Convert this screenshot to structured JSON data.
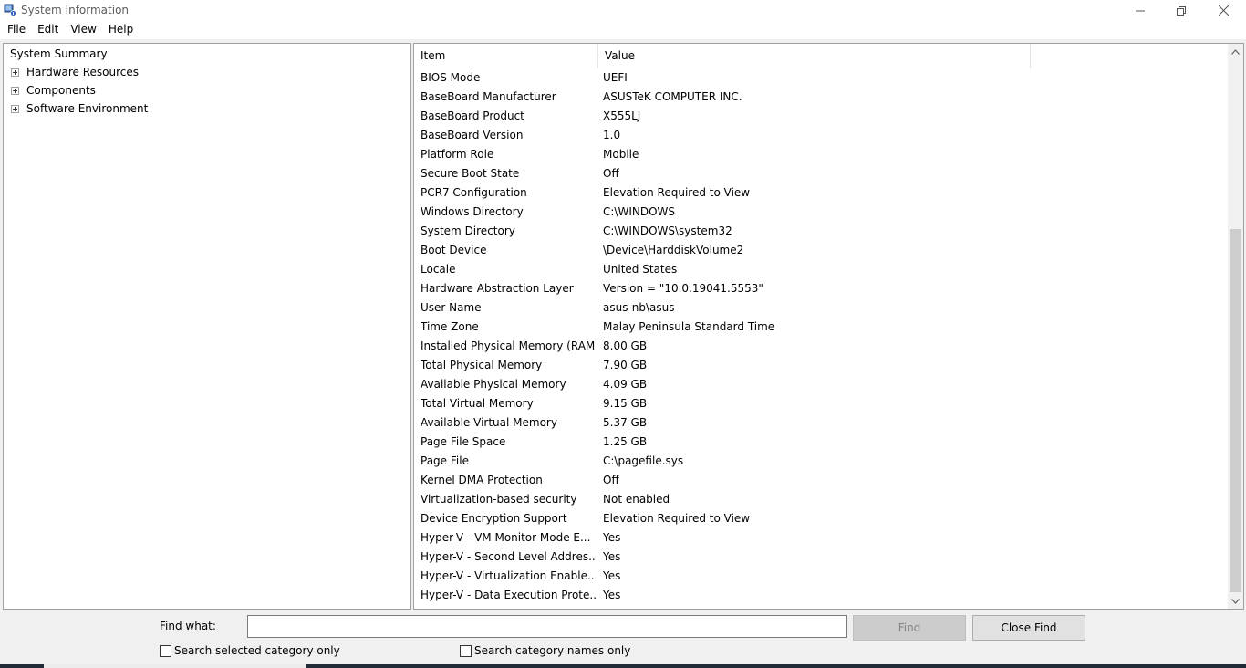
{
  "window": {
    "title": "System Information"
  },
  "menu": [
    "File",
    "Edit",
    "View",
    "Help"
  ],
  "tree": {
    "root": "System Summary",
    "nodes": [
      "Hardware Resources",
      "Components",
      "Software Environment"
    ]
  },
  "list": {
    "headers": {
      "item": "Item",
      "value": "Value"
    },
    "rows": [
      {
        "item": "BIOS Mode",
        "value": "UEFI"
      },
      {
        "item": "BaseBoard Manufacturer",
        "value": "ASUSTeK COMPUTER INC."
      },
      {
        "item": "BaseBoard Product",
        "value": "X555LJ"
      },
      {
        "item": "BaseBoard Version",
        "value": "1.0"
      },
      {
        "item": "Platform Role",
        "value": "Mobile"
      },
      {
        "item": "Secure Boot State",
        "value": "Off"
      },
      {
        "item": "PCR7 Configuration",
        "value": "Elevation Required to View"
      },
      {
        "item": "Windows Directory",
        "value": "C:\\WINDOWS"
      },
      {
        "item": "System Directory",
        "value": "C:\\WINDOWS\\system32"
      },
      {
        "item": "Boot Device",
        "value": "\\Device\\HarddiskVolume2"
      },
      {
        "item": "Locale",
        "value": "United States"
      },
      {
        "item": "Hardware Abstraction Layer",
        "value": "Version = \"10.0.19041.5553\""
      },
      {
        "item": "User Name",
        "value": "asus-nb\\asus"
      },
      {
        "item": "Time Zone",
        "value": "Malay Peninsula Standard Time"
      },
      {
        "item": "Installed Physical Memory (RAM)",
        "value": "8.00 GB"
      },
      {
        "item": "Total Physical Memory",
        "value": "7.90 GB"
      },
      {
        "item": "Available Physical Memory",
        "value": "4.09 GB"
      },
      {
        "item": "Total Virtual Memory",
        "value": "9.15 GB"
      },
      {
        "item": "Available Virtual Memory",
        "value": "5.37 GB"
      },
      {
        "item": "Page File Space",
        "value": "1.25 GB"
      },
      {
        "item": "Page File",
        "value": "C:\\pagefile.sys"
      },
      {
        "item": "Kernel DMA Protection",
        "value": "Off"
      },
      {
        "item": "Virtualization-based security",
        "value": "Not enabled"
      },
      {
        "item": "Device Encryption Support",
        "value": "Elevation Required to View"
      },
      {
        "item": "Hyper-V - VM Monitor Mode E...",
        "value": "Yes"
      },
      {
        "item": "Hyper-V - Second Level Addres...",
        "value": "Yes"
      },
      {
        "item": "Hyper-V - Virtualization Enable...",
        "value": "Yes"
      },
      {
        "item": "Hyper-V - Data Execution Prote...",
        "value": "Yes"
      }
    ]
  },
  "find": {
    "label": "Find what:",
    "value": "",
    "find_button": "Find",
    "close_button": "Close Find",
    "search_selected": "Search selected category only",
    "search_names": "Search category names only"
  }
}
